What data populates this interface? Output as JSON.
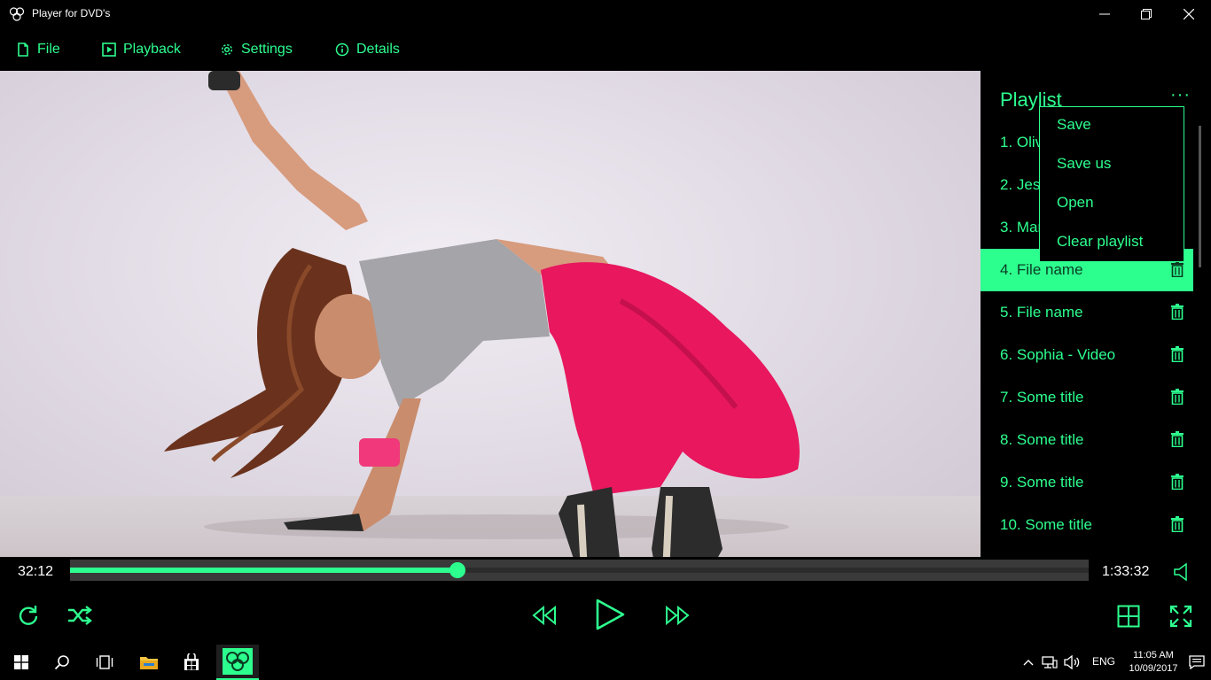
{
  "app": {
    "title": "Player for DVD's",
    "accent_color": "#2dff8f"
  },
  "window_controls": {
    "minimize_icon": "minimize-icon",
    "maximize_icon": "restore-icon",
    "close_icon": "close-icon"
  },
  "menu": {
    "file": {
      "label": "File",
      "icon": "file-icon"
    },
    "playback": {
      "label": "Playback",
      "icon": "play-square-icon"
    },
    "settings": {
      "label": "Settings",
      "icon": "gear-icon"
    },
    "details": {
      "label": "Details",
      "icon": "info-icon"
    }
  },
  "playlist": {
    "title": "Playlist",
    "more_label": "···",
    "items": [
      {
        "label": "1. Olivia"
      },
      {
        "label": "2. Jessica"
      },
      {
        "label": "3. Mary"
      },
      {
        "label": "4. File name",
        "active": true
      },
      {
        "label": "5. File name"
      },
      {
        "label": "6. Sophia - Video"
      },
      {
        "label": "7. Some title"
      },
      {
        "label": "8. Some title"
      },
      {
        "label": "9. Some title"
      },
      {
        "label": "10. Some title"
      }
    ]
  },
  "context_menu": {
    "items": [
      {
        "label": "Save"
      },
      {
        "label": "Save us"
      },
      {
        "label": "Open"
      },
      {
        "label": "Clear playlist"
      }
    ]
  },
  "player": {
    "current_time": "32:12",
    "total_time": "1:33:32",
    "progress_fraction": 0.38
  },
  "taskbar": {
    "language": "ENG",
    "time": "11:05 AM",
    "date": "10/09/2017"
  }
}
